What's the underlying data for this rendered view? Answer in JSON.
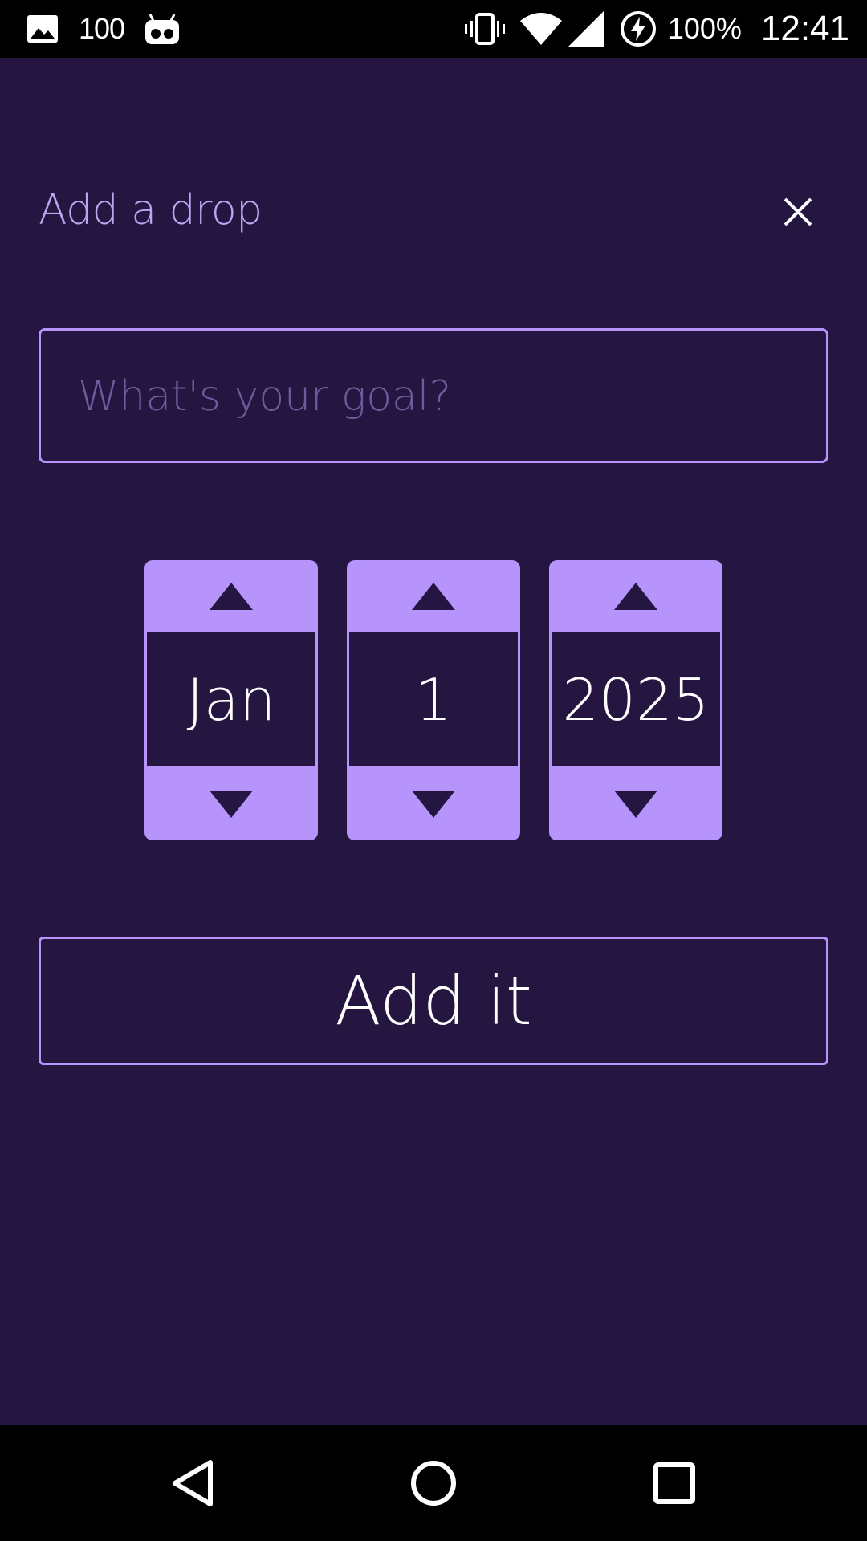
{
  "status_bar": {
    "notification_count": "100",
    "battery_percent": "100%",
    "time": "12:41",
    "left_icons": [
      "image-icon",
      "cyanogen-bot-icon"
    ],
    "right_icons": [
      "vibrate-icon",
      "wifi-icon",
      "signal-icon",
      "battery-charging-icon"
    ]
  },
  "header": {
    "title": "Add a drop",
    "close_icon": "close-icon"
  },
  "goal": {
    "placeholder": "What's your goal?",
    "value": ""
  },
  "date_picker": {
    "month": "Jan",
    "day": "1",
    "year": "2025"
  },
  "action": {
    "add_label": "Add it"
  },
  "nav_bar": {
    "icons": [
      "back-icon",
      "home-icon",
      "recents-icon"
    ]
  },
  "colors": {
    "background": "#241641",
    "accent": "#b794fc",
    "title_text": "#b9a6ef",
    "placeholder_text": "#6f5a9c"
  }
}
